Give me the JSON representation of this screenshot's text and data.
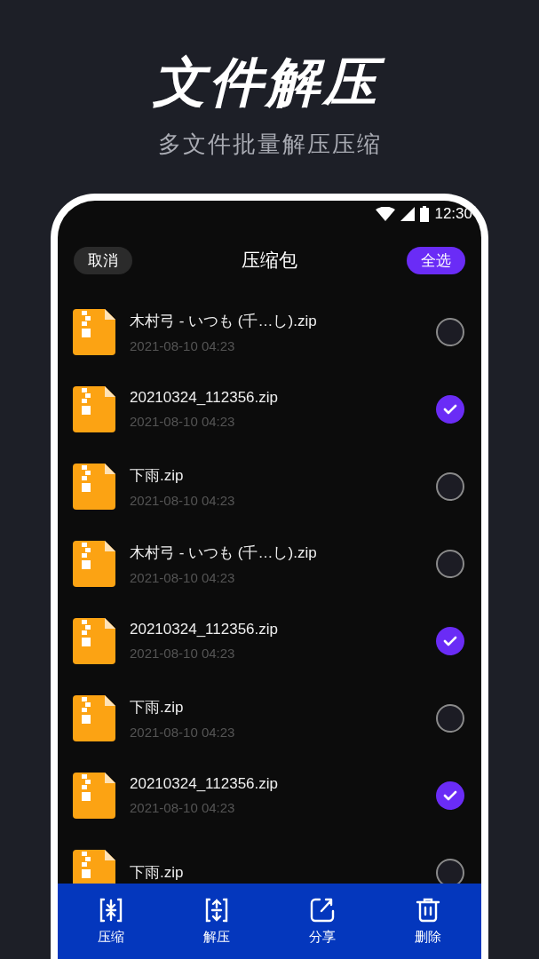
{
  "hero": {
    "title": "文件解压",
    "subtitle": "多文件批量解压压缩"
  },
  "status_bar": {
    "time": "12:30"
  },
  "header": {
    "cancel": "取消",
    "title": "压缩包",
    "select_all": "全选"
  },
  "files": [
    {
      "name": "木村弓 - いつも (千…し).zip",
      "date": "2021-08-10 04:23",
      "selected": false
    },
    {
      "name": "20210324_112356.zip",
      "date": "2021-08-10 04:23",
      "selected": true
    },
    {
      "name": "下雨.zip",
      "date": "2021-08-10 04:23",
      "selected": false
    },
    {
      "name": "木村弓 - いつも (千…し).zip",
      "date": "2021-08-10 04:23",
      "selected": false
    },
    {
      "name": "20210324_112356.zip",
      "date": "2021-08-10 04:23",
      "selected": true
    },
    {
      "name": "下雨.zip",
      "date": "2021-08-10 04:23",
      "selected": false
    },
    {
      "name": "20210324_112356.zip",
      "date": "2021-08-10 04:23",
      "selected": true
    },
    {
      "name": "下雨.zip",
      "selected": false
    }
  ],
  "bottom_bar": [
    {
      "kind": "compress",
      "label": "压缩"
    },
    {
      "kind": "extract",
      "label": "解压"
    },
    {
      "kind": "share",
      "label": "分享"
    },
    {
      "kind": "delete",
      "label": "删除"
    }
  ]
}
